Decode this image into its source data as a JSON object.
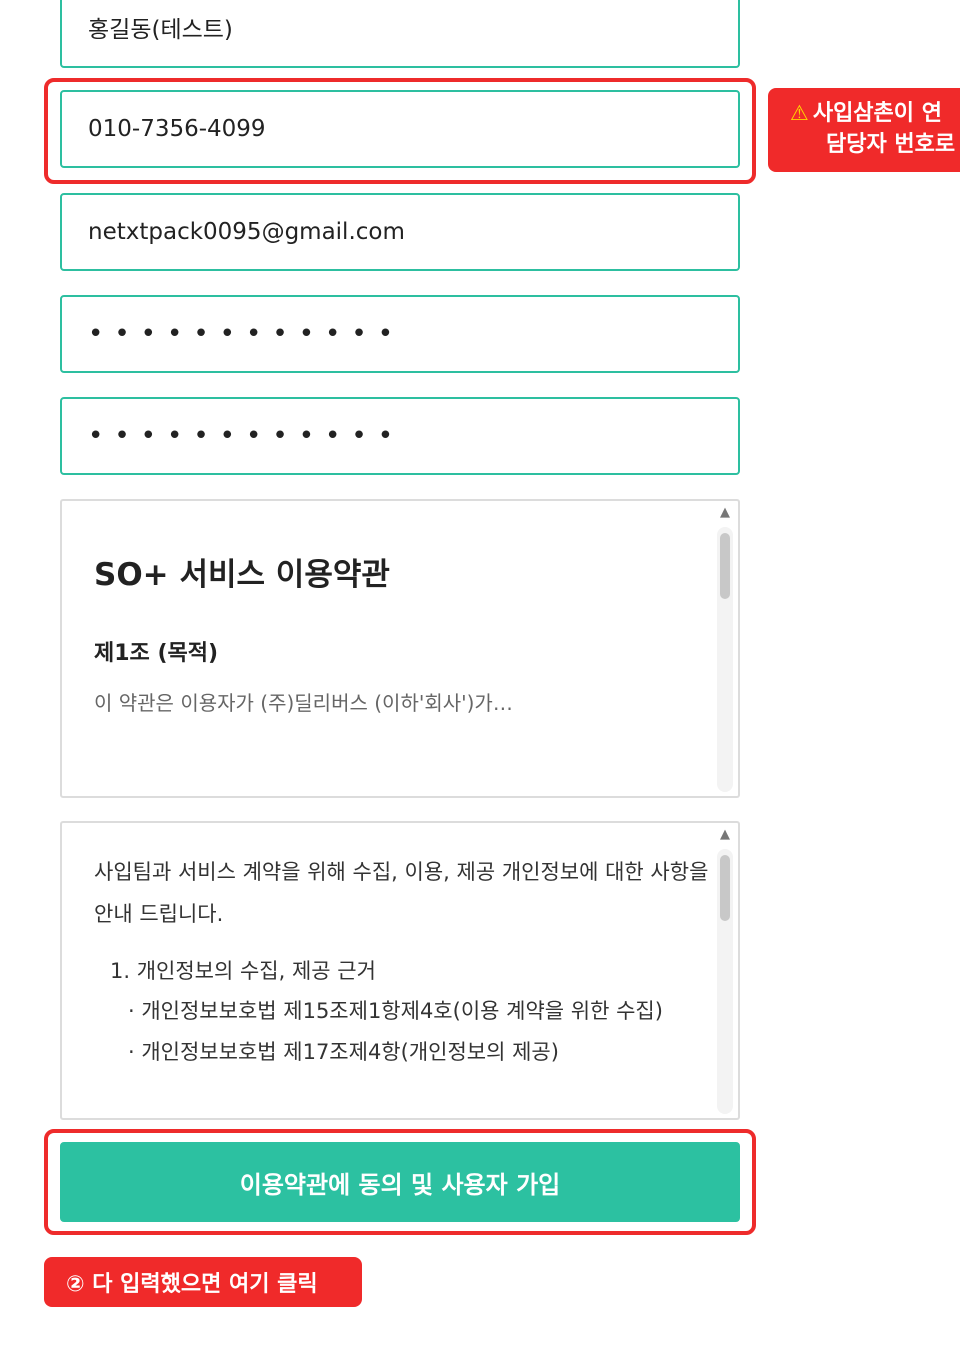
{
  "form": {
    "name_value": "홍길동(테스트)",
    "phone_value": "010-7356-4099",
    "email_value": "netxtpack0095@gmail.com",
    "password_mask": "••••••••••••",
    "password_confirm_mask": "••••••••••••"
  },
  "warning": {
    "icon": "warning-icon",
    "line1": "사입삼촌이 연",
    "line2": "담당자 번호로"
  },
  "terms": {
    "title": "SO+ 서비스 이용약관",
    "article_title": "제1조 (목적)",
    "article_body": "이 약관은 이용자가 (주)딜리버스 (이하'회사')가…"
  },
  "privacy": {
    "intro": "사입팀과 서비스 계약을 위해 수집, 이용, 제공 개인정보에 대한 사항을 안내 드립니다.",
    "item1": "1. 개인정보의 수집, 제공 근거",
    "sub1": "· 개인정보보호법 제15조제1항제4호(이용 계약을 위한 수집)",
    "sub2": "· 개인정보보호법 제17조제4항(개인정보의 제공)"
  },
  "actions": {
    "join_label": "이용약관에 동의 및 사용자 가입"
  },
  "annotation": {
    "click_hint": "② 다 입력했으면 여기 클릭"
  },
  "colors": {
    "accent": "#2cc1a1",
    "highlight": "#ee2b2b",
    "badge": "#f02a2a"
  }
}
